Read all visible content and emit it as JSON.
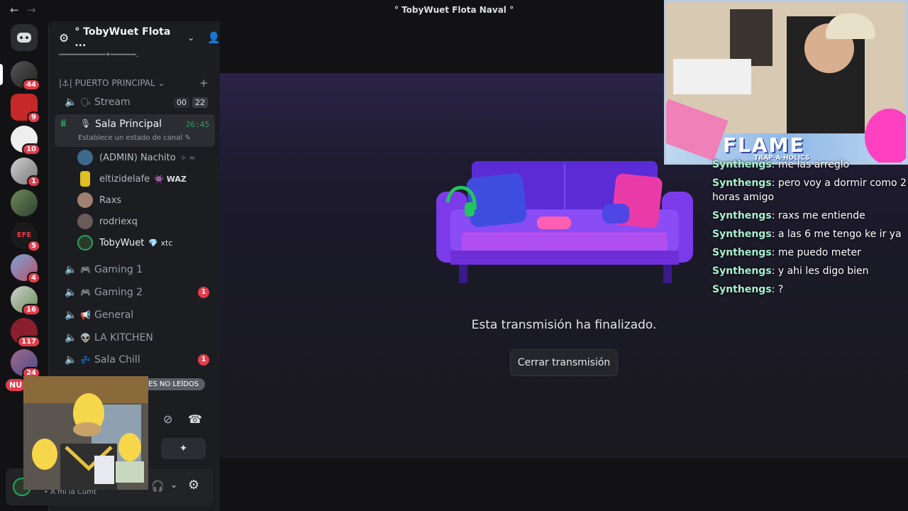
{
  "window": {
    "title": "° TobyWuet Flota Naval °",
    "back": "←",
    "forward": "→"
  },
  "guild": {
    "name": "° TobyWuet Flota ...",
    "banner_line": "━━━━━━━━━━━━━✦━━━━━━━.."
  },
  "category": {
    "label": "|⚓| PUERTO PRINCIPAL ⌄",
    "add": "+"
  },
  "servers": [
    {
      "badge": "44"
    },
    {
      "badge": "9"
    },
    {
      "badge": "10"
    },
    {
      "badge": "1"
    },
    {
      "badge": ""
    },
    {
      "badge": "5"
    },
    {
      "badge": "4"
    },
    {
      "badge": "16"
    },
    {
      "badge": "117"
    },
    {
      "badge": "24"
    }
  ],
  "channels": {
    "stream": {
      "emoji": "🗣",
      "name": "Stream",
      "count_left": "00",
      "count_right": "22"
    },
    "sala_principal": {
      "emoji": "🎙",
      "name": "Sala Principal",
      "timer": "26:45",
      "status": "Establece un estado de canal ✎"
    },
    "voice_users": [
      {
        "name": "(ADMIN) Nachito",
        "tag": "✧ ≈"
      },
      {
        "name": "eltizidelafe",
        "tag": "👾 WAZ"
      },
      {
        "name": "Raxs",
        "tag": ""
      },
      {
        "name": "rodriexq",
        "tag": ""
      },
      {
        "name": "TobyWuet",
        "tag": "💎 xtc"
      }
    ],
    "list": [
      {
        "emoji": "🎮",
        "name": "Gaming 1",
        "unread": ""
      },
      {
        "emoji": "🎮",
        "name": "Gaming 2",
        "unread": "1"
      },
      {
        "emoji": "📢",
        "name": "General",
        "unread": ""
      },
      {
        "emoji": "👽",
        "name": "LA KITCHEN",
        "unread": ""
      },
      {
        "emoji": "💤",
        "name": "Sala Chill",
        "unread": "1"
      }
    ]
  },
  "unread_bar": {
    "new_label": "NU",
    "label": "ES NO LEÍDOS"
  },
  "userpanel": {
    "status": "• A mi la Cumt"
  },
  "stream": {
    "ended_text": "Esta transmisión ha finalizado.",
    "close_button": "Cerrar transmisión"
  },
  "overlay": {
    "banner": "FLAME",
    "sub": "TRAP-A-HOLICS"
  },
  "chat": [
    {
      "user": "Synthengs",
      "text": "me las arreglo"
    },
    {
      "user": "Synthengs",
      "text": "pero voy a dormir como 2 horas amigo"
    },
    {
      "user": "Synthengs",
      "text": "raxs me entiende"
    },
    {
      "user": "Synthengs",
      "text": "a las 6 me tengo ke ir ya"
    },
    {
      "user": "Synthengs",
      "text": "me puedo meter"
    },
    {
      "user": "Synthengs",
      "text": "y ahi les digo bien"
    },
    {
      "user": "Synthengs",
      "text": "?"
    }
  ],
  "colors": {
    "accent": "#23a55a",
    "danger": "#e23d4b",
    "brand": "#5865f2"
  }
}
